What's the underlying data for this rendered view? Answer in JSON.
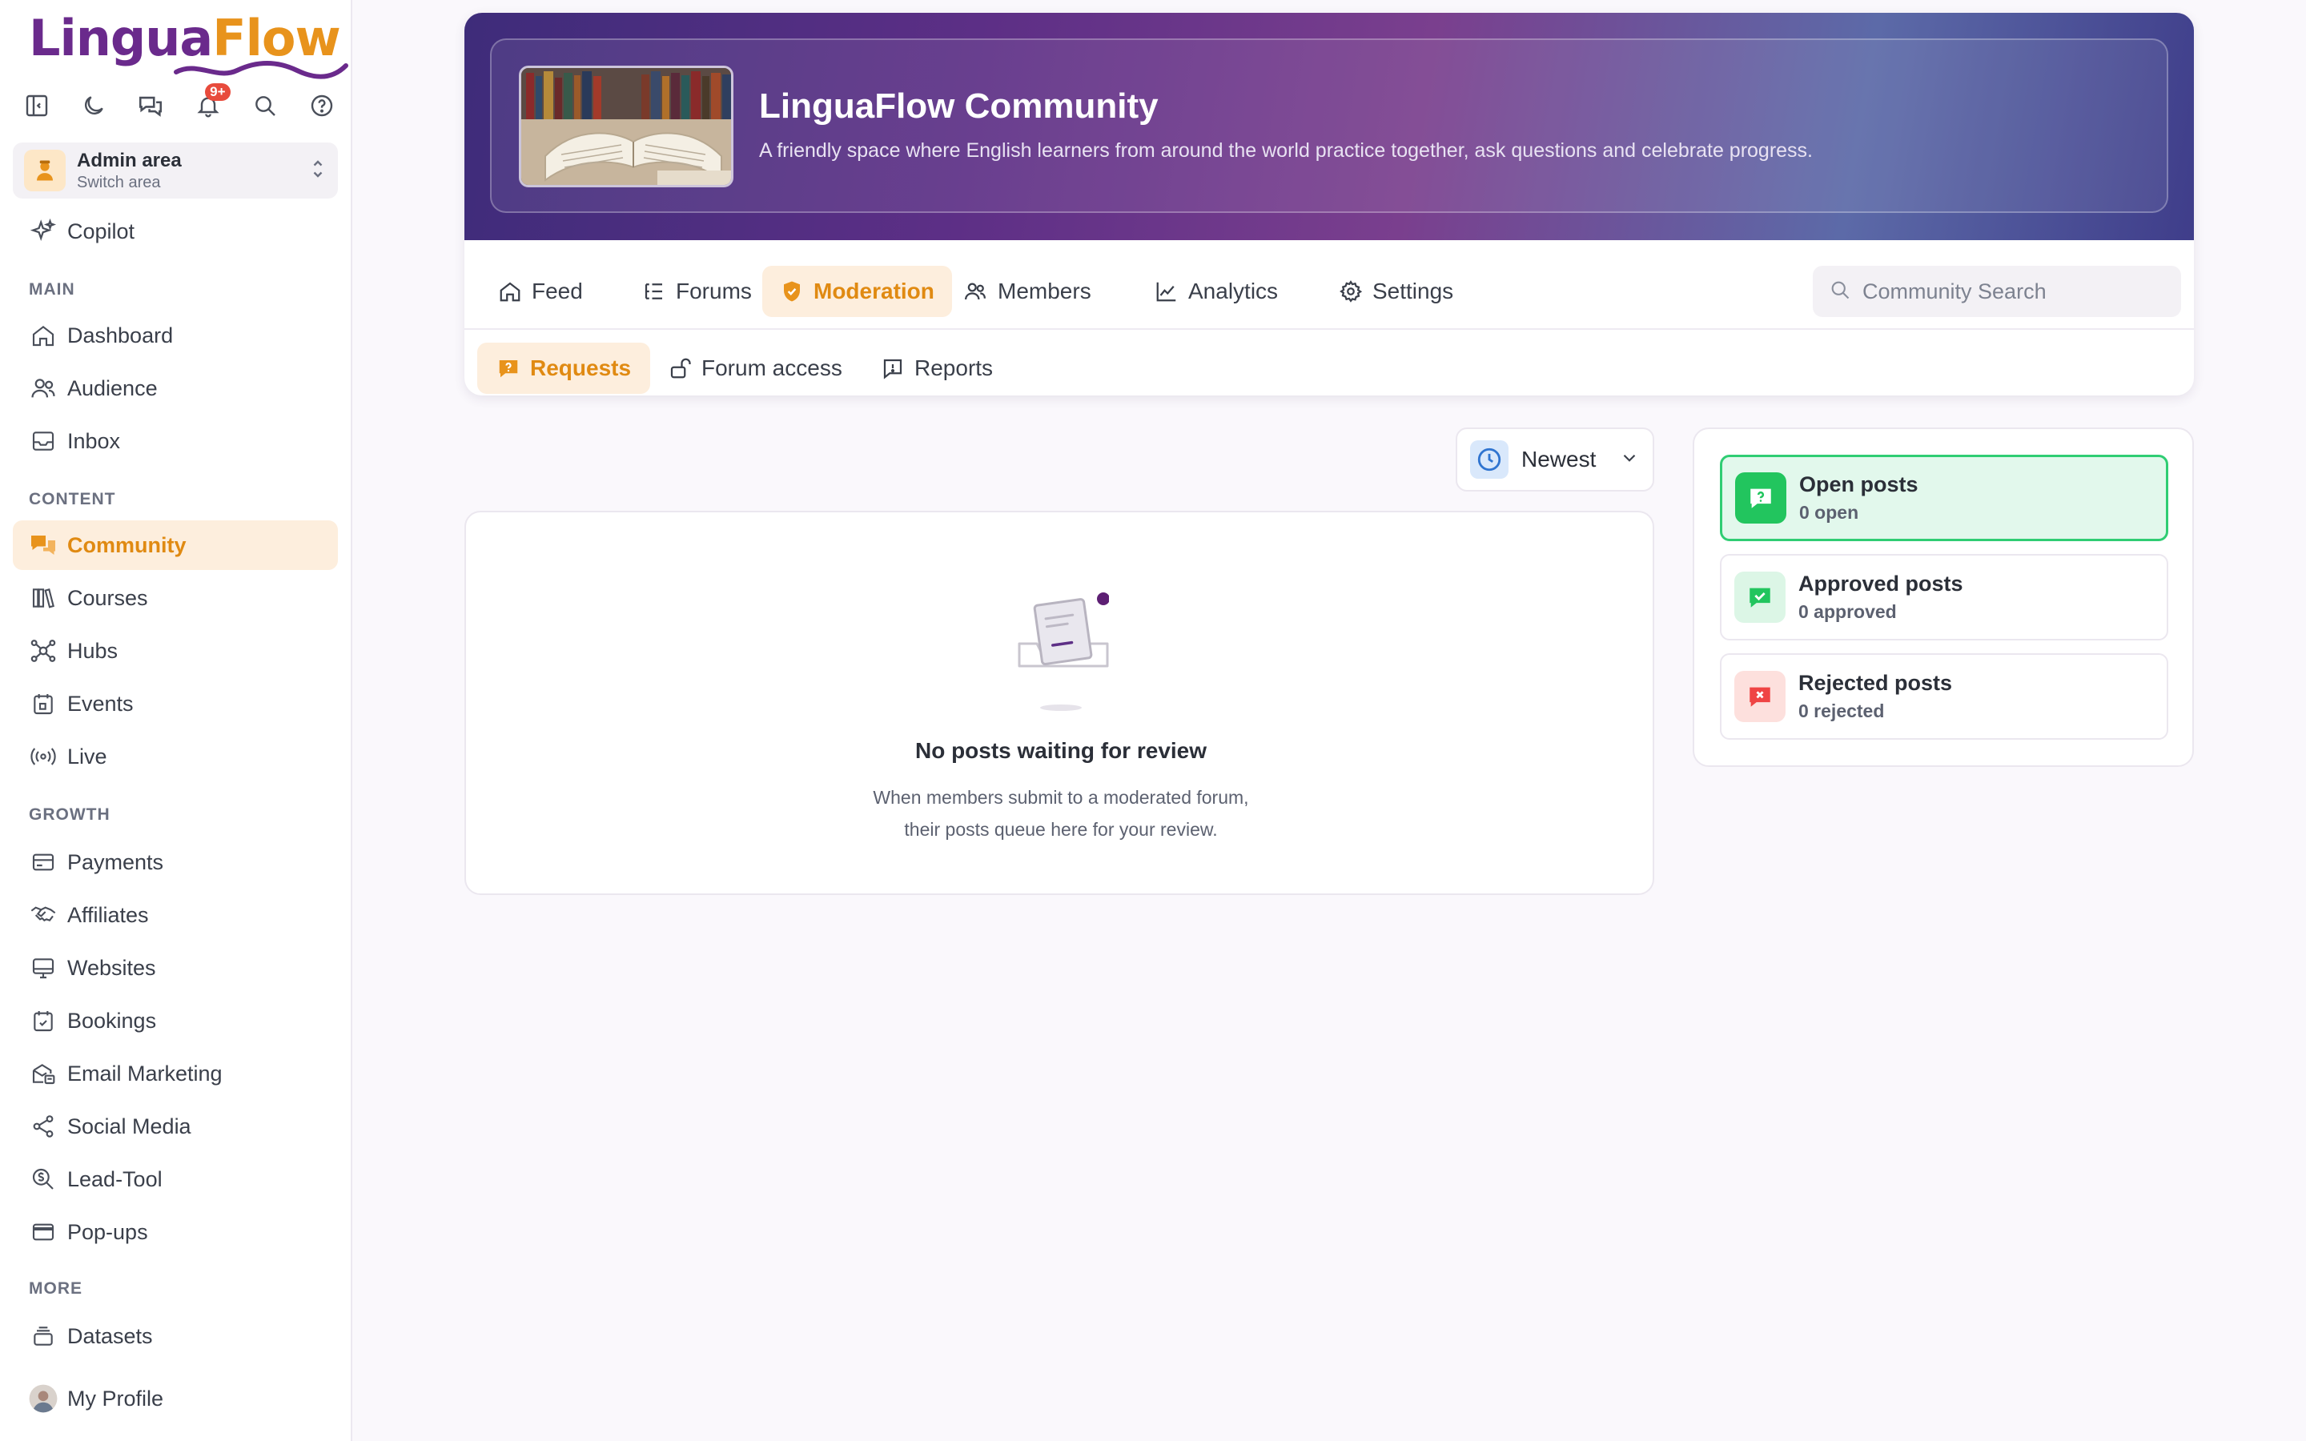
{
  "brand": {
    "name_part1": "Lingua",
    "name_part2": "Flow",
    "notification_count": "9+"
  },
  "area_switcher": {
    "title": "Admin area",
    "subtitle": "Switch area"
  },
  "sidebar": {
    "copilot": "Copilot",
    "sections": {
      "main": "MAIN",
      "content": "CONTENT",
      "growth": "GROWTH",
      "more": "MORE"
    },
    "items": {
      "dashboard": "Dashboard",
      "audience": "Audience",
      "inbox": "Inbox",
      "community": "Community",
      "courses": "Courses",
      "hubs": "Hubs",
      "events": "Events",
      "live": "Live",
      "payments": "Payments",
      "affiliates": "Affiliates",
      "websites": "Websites",
      "bookings": "Bookings",
      "email_marketing": "Email Marketing",
      "social_media": "Social Media",
      "lead_tool": "Lead-Tool",
      "popups": "Pop-ups",
      "datasets": "Datasets",
      "my_profile": "My Profile"
    },
    "active_item": "community"
  },
  "community": {
    "title": "LinguaFlow Community",
    "description": "A friendly space where English learners from around the world practice together, ask questions and celebrate progress."
  },
  "tabs": {
    "feed": "Feed",
    "forums": "Forums",
    "moderation": "Moderation",
    "members": "Members",
    "analytics": "Analytics",
    "settings": "Settings",
    "active": "moderation"
  },
  "search": {
    "placeholder": "Community Search",
    "value": ""
  },
  "subtabs": {
    "requests": "Requests",
    "forum_access": "Forum access",
    "reports": "Reports",
    "active": "requests"
  },
  "sort": {
    "selected": "Newest"
  },
  "empty_state": {
    "title": "No posts waiting for review",
    "line1": "When members submit to a moderated forum,",
    "line2": "their posts queue here for your review."
  },
  "stats": {
    "open": {
      "title": "Open posts",
      "count": "0 open",
      "color": "#22c55e"
    },
    "approved": {
      "title": "Approved posts",
      "count": "0 approved",
      "color": "#22c55e"
    },
    "rejected": {
      "title": "Rejected posts",
      "count": "0 rejected",
      "color": "#ef4444"
    },
    "active": "open"
  },
  "colors": {
    "accent": "#e08a12",
    "accent_bg": "#fdeedd",
    "brand_purple": "#6a2a8c"
  }
}
